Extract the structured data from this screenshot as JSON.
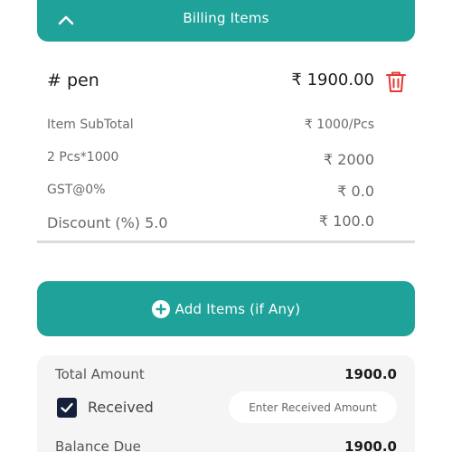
{
  "header": {
    "title": "Billing Items",
    "collapse_icon": "chevron-up-icon"
  },
  "item": {
    "name": "# pen",
    "price": "₹ 1900.00",
    "delete_icon": "trash-icon",
    "delete_color": "#e53935",
    "rows": [
      {
        "label": "Item SubTotal",
        "value": "₹ 1000/Pcs"
      },
      {
        "label": "2 Pcs*1000",
        "value": "₹ 2000"
      },
      {
        "label": "GST@0%",
        "value": "₹ 0.0"
      },
      {
        "label": "Discount (%) 5.0",
        "value": "₹ 100.0"
      }
    ]
  },
  "add_button": {
    "label": "Add Items (if Any)",
    "icon": "plus-circle-icon"
  },
  "summary": {
    "total_label": "Total Amount",
    "total_value": "1900.0",
    "received_label": "Received",
    "received_checked": true,
    "received_placeholder": "Enter Received Amount",
    "balance_label": "Balance Due",
    "balance_value": "1900.0"
  },
  "colors": {
    "primary": "#1fa29a",
    "checkbox": "#15213a",
    "danger": "#e53935"
  }
}
